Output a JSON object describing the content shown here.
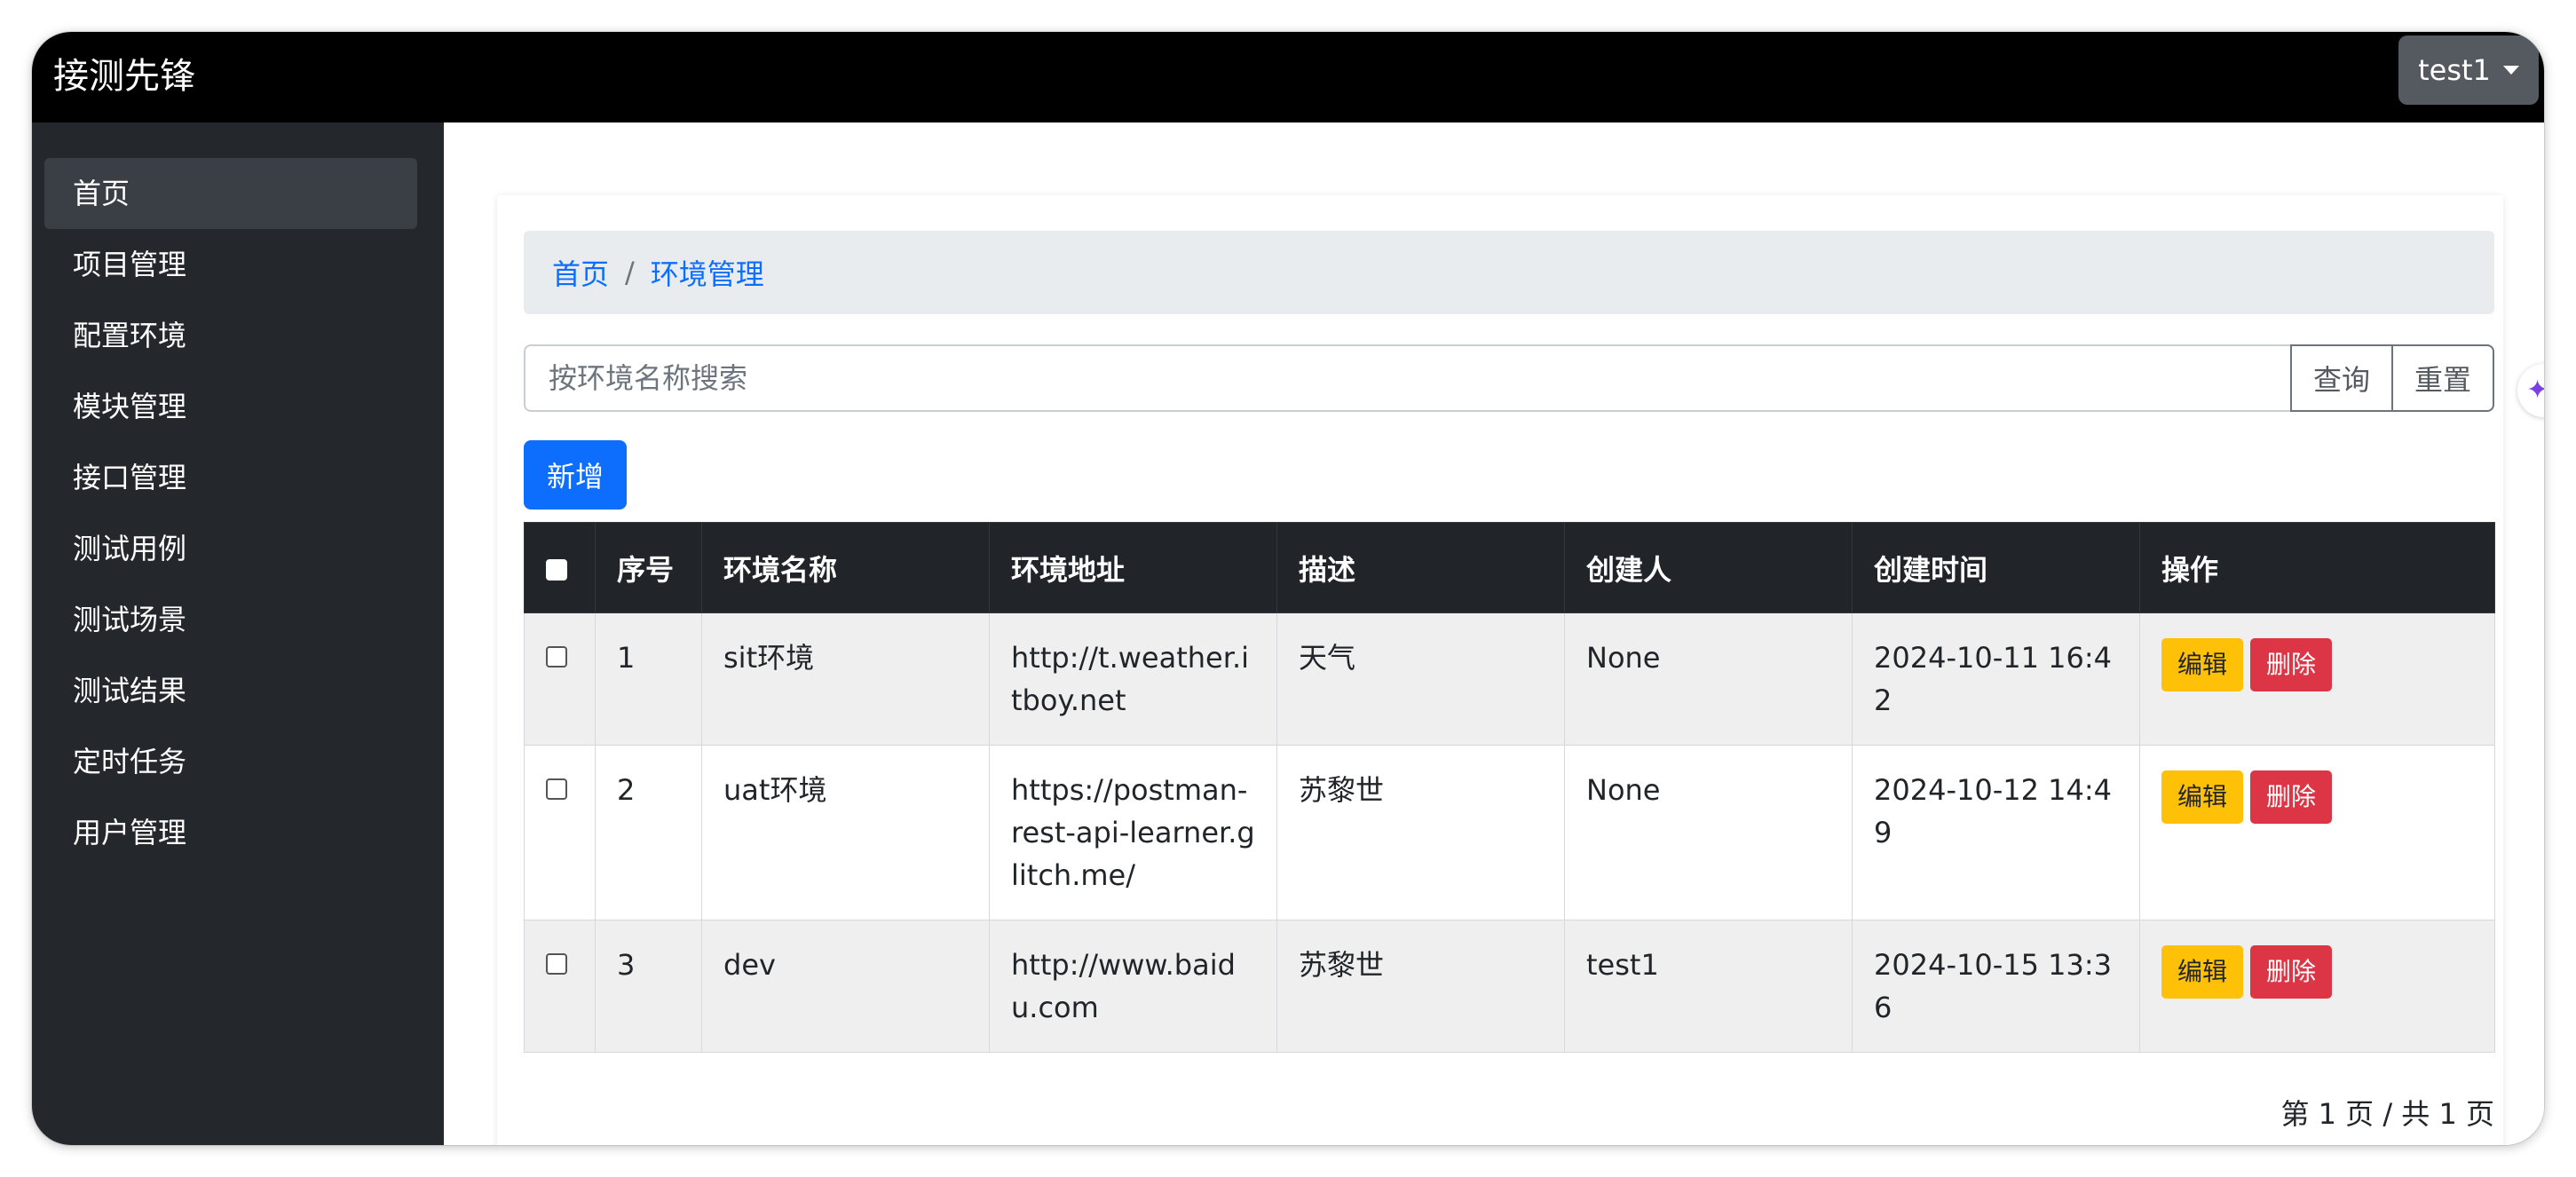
{
  "app": {
    "brand": "接测先锋",
    "user": "test1"
  },
  "sidebar": {
    "items": [
      {
        "label": "首页",
        "active": true
      },
      {
        "label": "项目管理"
      },
      {
        "label": "配置环境"
      },
      {
        "label": "模块管理"
      },
      {
        "label": "接口管理"
      },
      {
        "label": "测试用例"
      },
      {
        "label": "测试场景"
      },
      {
        "label": "测试结果"
      },
      {
        "label": "定时任务"
      },
      {
        "label": "用户管理"
      }
    ]
  },
  "breadcrumb": {
    "home": "首页",
    "separator": "/",
    "current": "环境管理"
  },
  "search": {
    "placeholder": "按环境名称搜索",
    "value": "",
    "query_label": "查询",
    "reset_label": "重置"
  },
  "toolbar": {
    "add_label": "新增"
  },
  "table": {
    "headers": [
      "序号",
      "环境名称",
      "环境地址",
      "描述",
      "创建人",
      "创建时间",
      "操作"
    ],
    "rows": [
      {
        "index": "1",
        "name": "sit环境",
        "url": "http://t.weather.itboy.net",
        "desc": "天气",
        "creator": "None",
        "created": "2024-10-11 16:42"
      },
      {
        "index": "2",
        "name": "uat环境",
        "url": "https://postman-rest-api-learner.glitch.me/",
        "desc": "苏黎世",
        "creator": "None",
        "created": "2024-10-12 14:49"
      },
      {
        "index": "3",
        "name": "dev",
        "url": "http://www.baidu.com",
        "desc": "苏黎世",
        "creator": "test1",
        "created": "2024-10-15 13:36"
      }
    ],
    "actions": {
      "edit_label": "编辑",
      "delete_label": "删除"
    }
  },
  "pagination": {
    "text": "第 1 页 / 共 1 页"
  },
  "colors": {
    "primary": "#0d6efd",
    "warning": "#ffc107",
    "danger": "#dc3545",
    "sidebar": "#24282d",
    "navbar": "#000000"
  }
}
